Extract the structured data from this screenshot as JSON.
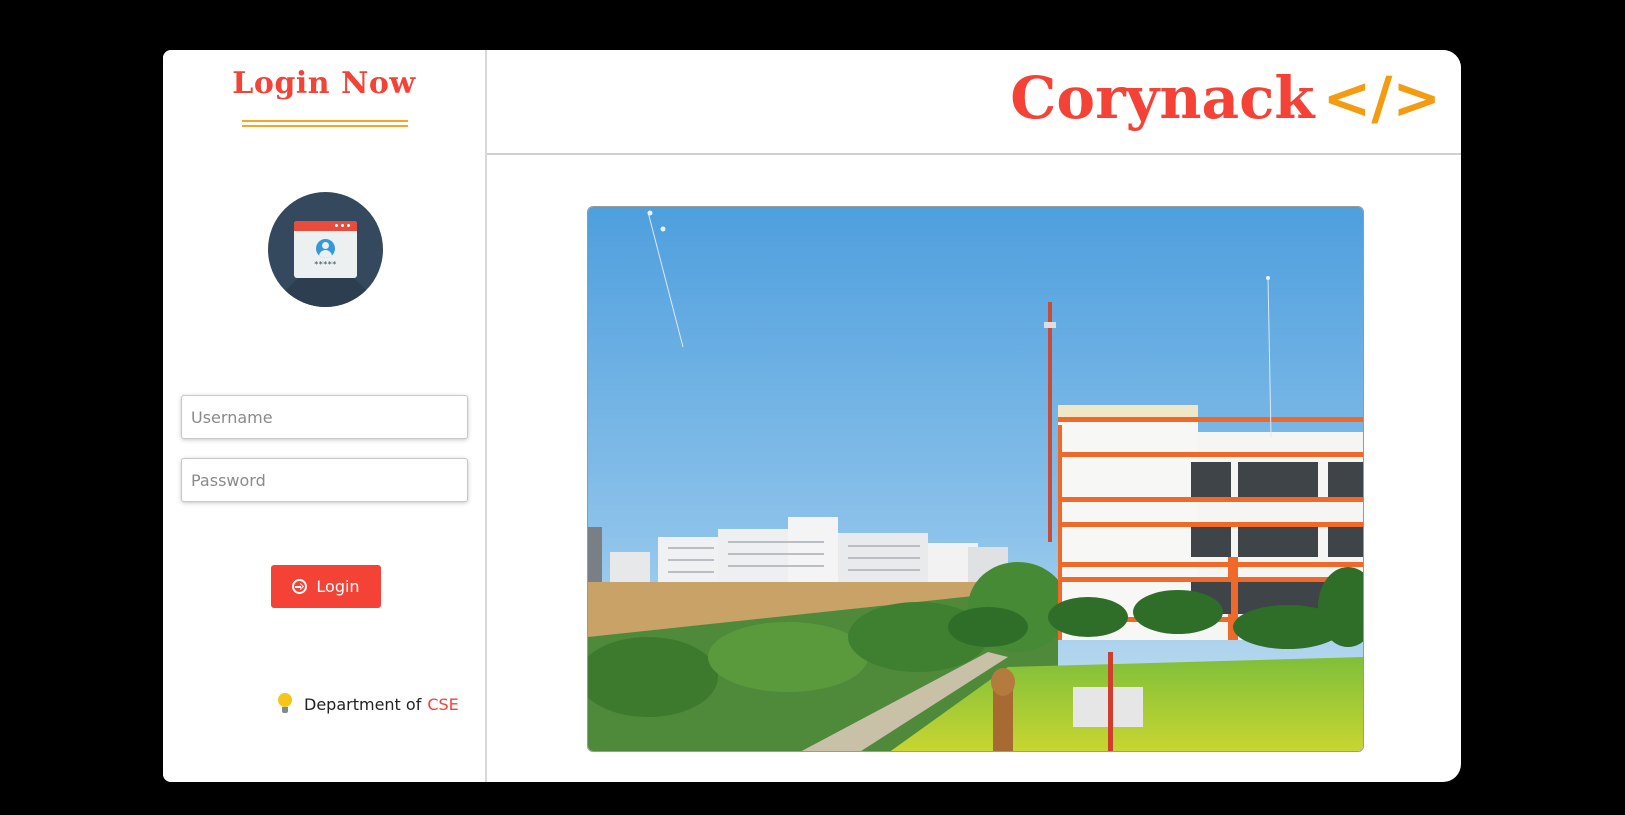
{
  "login_panel": {
    "title": "Login Now",
    "username_placeholder": "Username",
    "password_placeholder": "Password",
    "login_button": "Login",
    "footer_prefix": "Department of",
    "footer_highlight": "CSE",
    "avatar_stars": "*****"
  },
  "header": {
    "brand": "Corynack",
    "brand_code": "</>"
  },
  "icons": {
    "avatar": "login-window-icon",
    "login": "sign-in-icon",
    "bulb": "lightbulb-icon"
  },
  "colors": {
    "accent": "#f44336",
    "underline": "#f5a623",
    "code": "#f39c12",
    "avatar_bg": "#34495e"
  }
}
